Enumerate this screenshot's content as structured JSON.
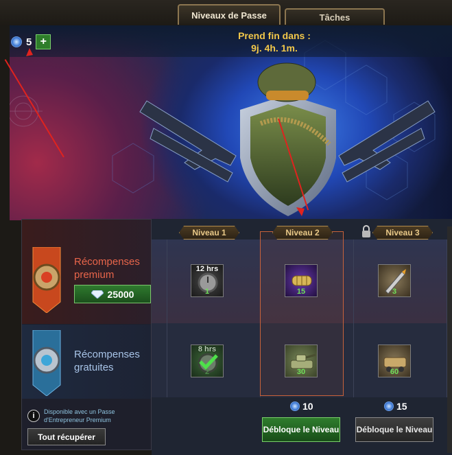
{
  "tabs": [
    {
      "label": "Niveaux de Passe",
      "active": true
    },
    {
      "label": "Tâches",
      "active": false
    }
  ],
  "tokens": {
    "count": "5",
    "plus": "+",
    "icon": "token-icon"
  },
  "timer": {
    "line1": "Prend fin dans :",
    "line2": "9j. 4h. 1m."
  },
  "left": {
    "premium_label": "Récompenses premium",
    "premium_price": "25000",
    "free_label": "Récompenses gratuites",
    "info_text": "Disponible avec un Passe d'Entrepreneur Premium",
    "info_icon": "i",
    "collect_all": "Tout récupérer"
  },
  "levels": [
    {
      "label": "Niveau 1",
      "locked": false,
      "premium": {
        "top": "12 hrs",
        "bottom": "1",
        "icon": "speedup-clock-icon"
      },
      "free": {
        "top": "8 hrs",
        "bottom": "2",
        "icon": "speedup-clock-icon",
        "claimed": true
      },
      "cost": "",
      "unlock": ""
    },
    {
      "label": "Niveau 2",
      "locked": false,
      "premium": {
        "top": "",
        "bottom": "15",
        "icon": "capsule-icon"
      },
      "free": {
        "top": "",
        "bottom": "30",
        "icon": "tank-icon"
      },
      "cost": "10",
      "unlock": "Débloque le Niveau"
    },
    {
      "label": "Niveau 3",
      "locked": true,
      "premium": {
        "top": "",
        "bottom": "3",
        "icon": "missile-icon"
      },
      "free": {
        "top": "",
        "bottom": "60",
        "icon": "armored-vehicle-icon"
      },
      "cost": "15",
      "unlock": "Débloque le Niveau"
    }
  ],
  "colors": {
    "accent": "#f2c84a",
    "green": "#2f7d2d",
    "premium": "#e8654a",
    "free": "#a8c4e8"
  }
}
